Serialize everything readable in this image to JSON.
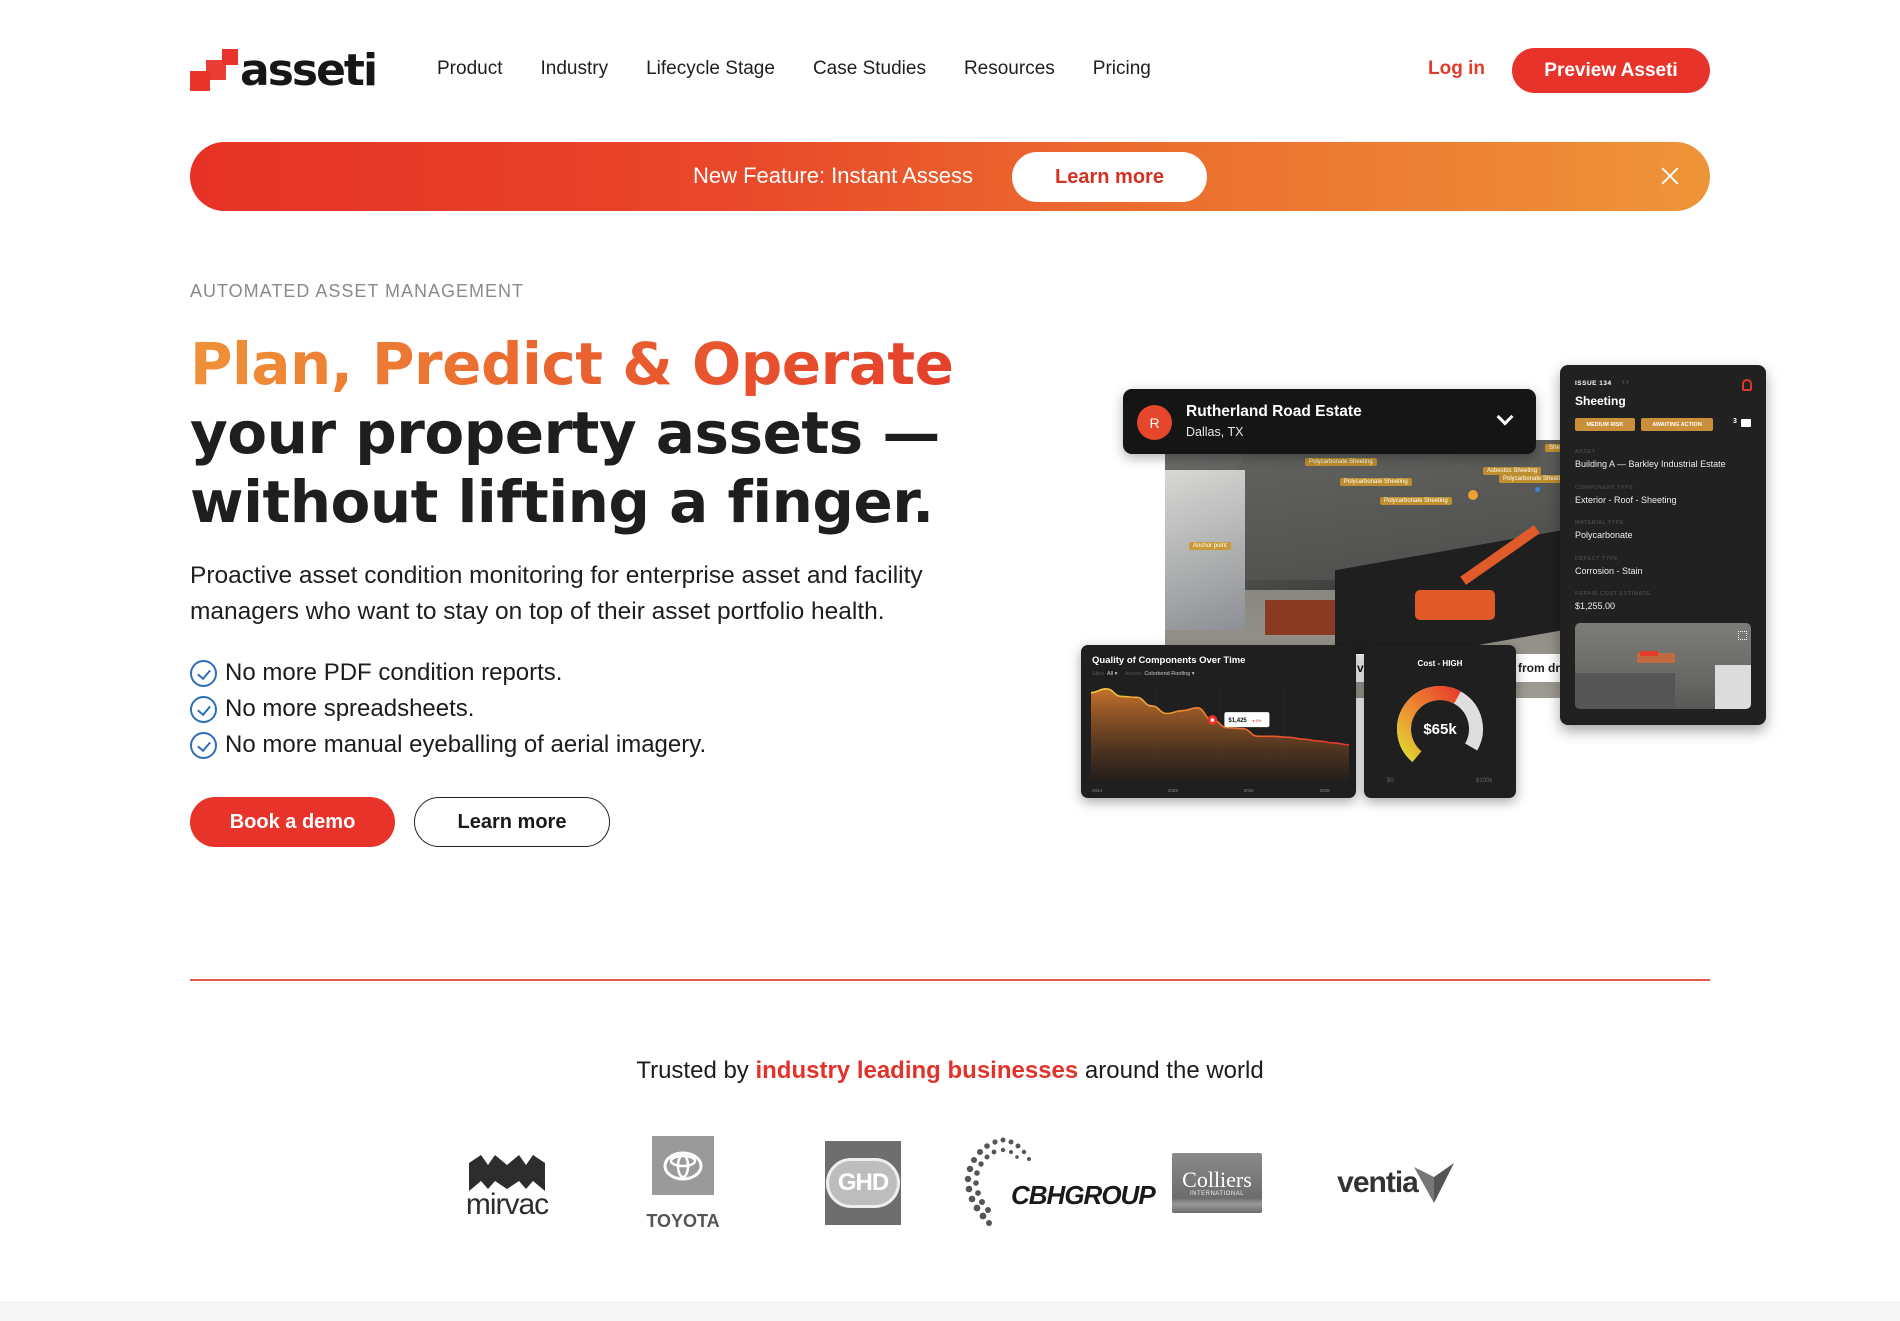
{
  "brand": {
    "name": "asseti",
    "accent": "#e8332a",
    "accent_orange": "#ee9438"
  },
  "nav": {
    "links": [
      "Product",
      "Industry",
      "Lifecycle Stage",
      "Case Studies",
      "Resources",
      "Pricing"
    ],
    "login": "Log in",
    "cta": "Preview Asseti"
  },
  "banner": {
    "text": "New Feature: Instant Assess",
    "button": "Learn more",
    "close_icon": "close-icon"
  },
  "hero": {
    "eyebrow": "AUTOMATED ASSET MANAGEMENT",
    "headline_highlight": "Plan, Predict & Operate",
    "headline_line2": "your property assets —",
    "headline_line3": "without lifting a finger.",
    "lead": "Proactive asset condition monitoring for enterprise asset and facility managers who want to stay on top of their asset portfolio health.",
    "checklist": [
      "No more PDF condition reports.",
      "No more spreadsheets.",
      "No more manual eyeballing of aerial imagery."
    ],
    "primary_button": "Book a demo",
    "secondary_button": "Learn more"
  },
  "mockup": {
    "estate": {
      "avatar": "R",
      "name": "Rutherland Road Estate",
      "location": "Dallas, TX"
    },
    "aerial_tags": [
      "Polycarbonate Sheeting",
      "Polycarbonate Sheeting",
      "Polycarbonate Sheeting",
      "Asbestos Sheeting",
      "Polycarbonate Sheeting",
      "Anchor point",
      "Sheeting"
    ],
    "strip_left": "v",
    "strip_right": "from dr",
    "issue": {
      "number": "ISSUE 134",
      "title": "Sheeting",
      "badges": [
        "MEDIUM RISK",
        "AWAITING ACTION"
      ],
      "comments": "3",
      "fields": [
        {
          "label": "ASSET",
          "value": "Building A — Barkley Industrial Estate"
        },
        {
          "label": "COMPONENT TYPE",
          "value": "Exterior - Roof - Sheeting"
        },
        {
          "label": "MATERIAL TYPE",
          "value": "Polycarbonate"
        },
        {
          "label": "DEFECT TYPE",
          "value": "Corrosion - Stain"
        },
        {
          "label": "REPAIR COST ESTIMATE",
          "value": "$1,255.00"
        }
      ]
    },
    "quality_chart": {
      "title": "Quality of Components Over Time",
      "filter_sites_label": "Sites",
      "filter_sites_value": "All ▾",
      "filter_assets_label": "Assets",
      "filter_assets_value": "Colorbond Roofing ▾",
      "tooltip_value": "$1,425",
      "tooltip_delta": "▾ 8%"
    },
    "gauge": {
      "title": "Cost - HIGH",
      "value_label": "$65k",
      "min_label": "$0",
      "max_label": "$100k",
      "fraction": 0.65
    }
  },
  "chart_data": {
    "type": "area",
    "title": "Quality of Components Over Time",
    "x_ticks": [
      "2024",
      "2029",
      "2034",
      "2039"
    ],
    "x": [
      2024,
      2025,
      2026,
      2027,
      2028,
      2029,
      2030,
      2031,
      2032,
      2033,
      2034,
      2035,
      2036,
      2037,
      2038,
      2039,
      2040,
      2041
    ],
    "values": [
      92,
      96,
      88,
      87,
      78,
      70,
      73,
      76,
      63,
      55,
      54,
      46,
      46,
      45,
      43,
      41,
      39,
      37
    ],
    "highlight": {
      "x": 2032,
      "label": "$1,425",
      "delta": "-8%"
    },
    "ylim": [
      0,
      100
    ],
    "grid": true
  },
  "trusted": {
    "prefix": "Trusted by ",
    "accent": "industry leading businesses",
    "suffix": " around the world",
    "logos": [
      "mirvac",
      "TOYOTA",
      "GHD",
      "CBHGROUP",
      "Colliers",
      "INTERNATIONAL",
      "ventia"
    ]
  }
}
